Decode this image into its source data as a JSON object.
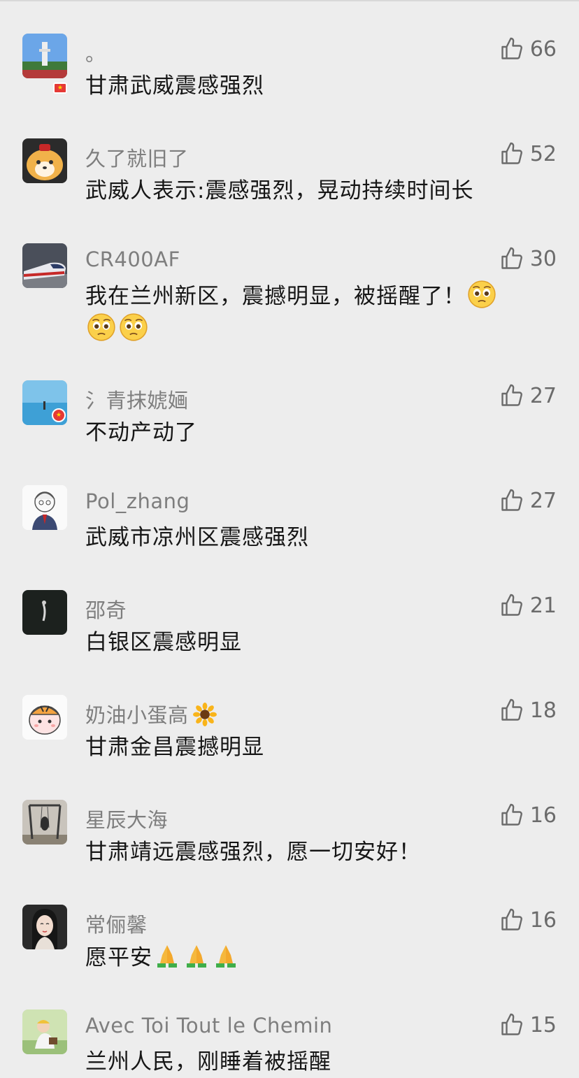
{
  "comments": [
    {
      "name": "。",
      "text": "甘肃武威震感强烈",
      "likes": "66",
      "avatar": "tower-photo-avatar"
    },
    {
      "name": "久了就旧了",
      "text": "武威人表示:震感强烈，晃动持续时间长",
      "likes": "52",
      "avatar": "shiba-dog-avatar"
    },
    {
      "name": "CR400AF",
      "text": "我在兰州新区，震撼明显，被摇醒了！",
      "likes": "30",
      "avatar": "bullet-train-avatar"
    },
    {
      "name": "氵青抹婋婳",
      "text": "不动产动了",
      "likes": "27",
      "avatar": "sea-photo-avatar"
    },
    {
      "name": "Pol_zhang",
      "text": "武威市凉州区震感强烈",
      "likes": "27",
      "avatar": "cartoon-man-avatar"
    },
    {
      "name": "邵奇",
      "text": "白银区震感明显",
      "likes": "21",
      "avatar": "dark-photo-avatar"
    },
    {
      "name": "奶油小蛋高",
      "text": "甘肃金昌震撼明显",
      "likes": "18",
      "avatar": "tiger-girl-avatar"
    },
    {
      "name": "星辰大海",
      "text": "甘肃靖远震感强烈，愿一切安好！",
      "likes": "16",
      "avatar": "swing-photo-avatar"
    },
    {
      "name": "常俪馨",
      "text": "愿平安",
      "likes": "16",
      "avatar": "woman-portrait-avatar"
    },
    {
      "name": "Avec Toi Tout le Chemin",
      "text": "兰州人民，刚睡着被摇醒",
      "likes": "15",
      "avatar": "child-photo-avatar"
    }
  ],
  "icons": {
    "like": "thumbs-up-icon",
    "flag": "china-flag-icon",
    "emoji_worried": "pleading-face-emoji",
    "pray": "folded-hands-emoji",
    "sunflower": "sunflower-emoji"
  },
  "colors": {
    "background": "#ededed",
    "name": "#7e7e7e",
    "text": "#161616",
    "like": "#6b6b6b"
  }
}
